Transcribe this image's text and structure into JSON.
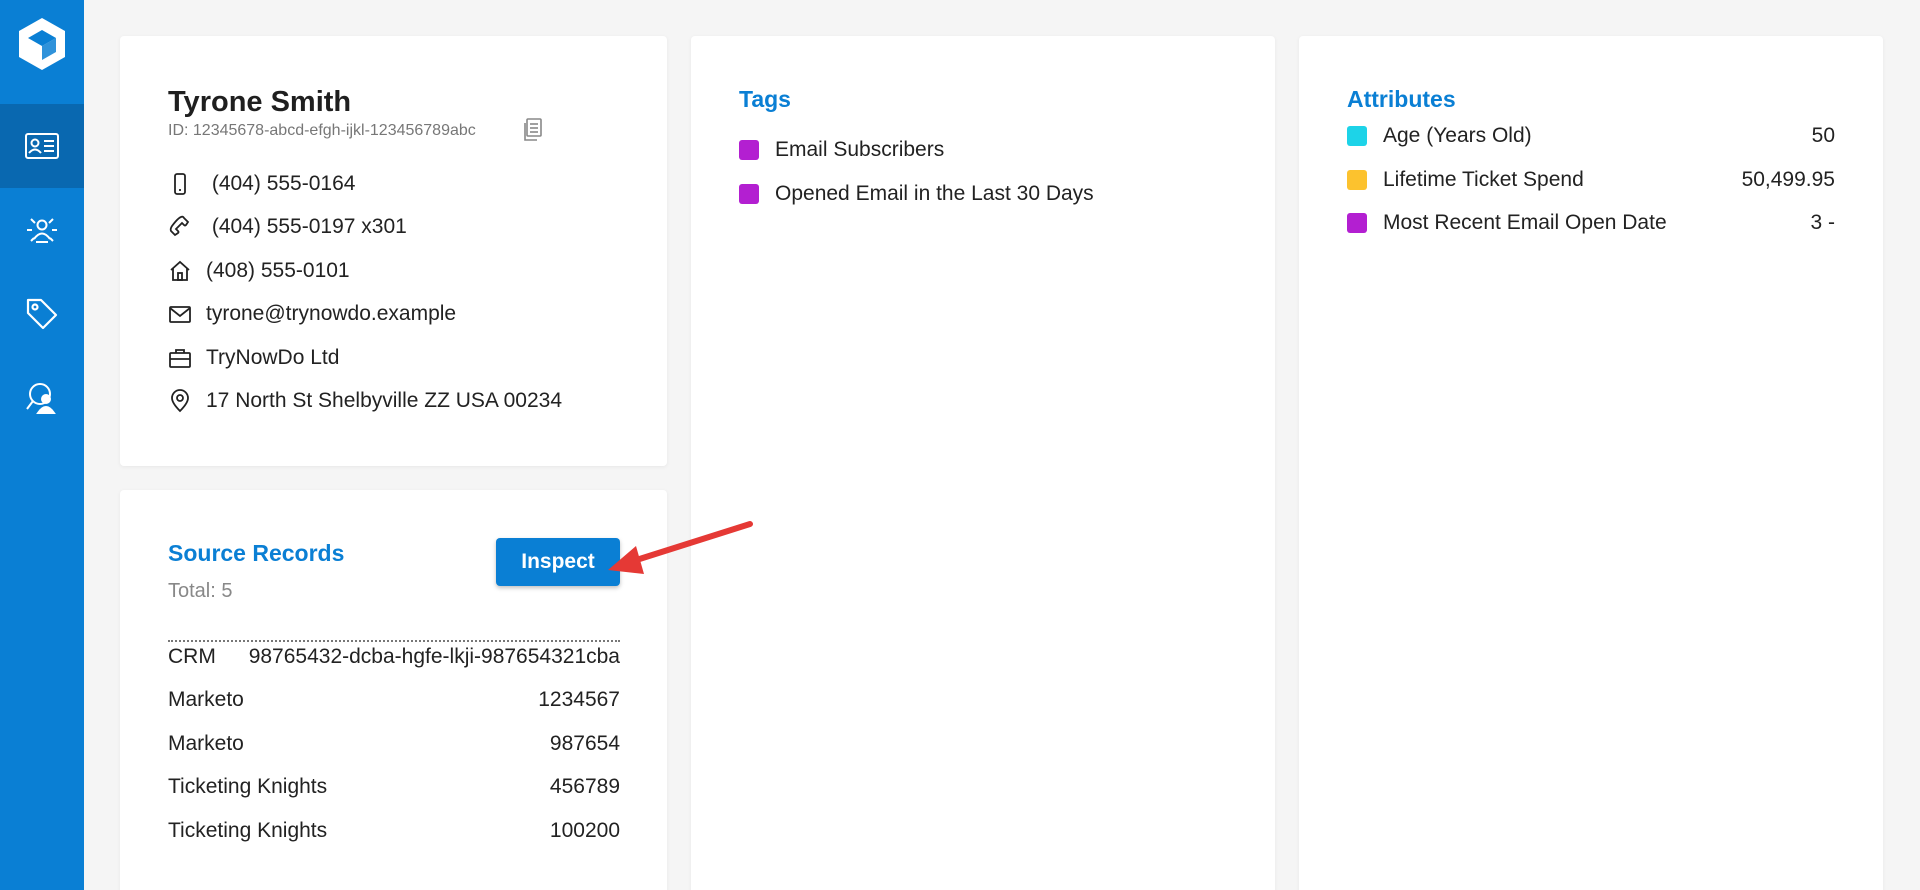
{
  "sidebar": {
    "items": [
      {
        "icon": "contact-card-icon",
        "active": true
      },
      {
        "icon": "people-network-icon",
        "active": false
      },
      {
        "icon": "tag-icon",
        "active": false
      },
      {
        "icon": "person-search-icon",
        "active": false
      }
    ]
  },
  "profile": {
    "name": "Tyrone Smith",
    "id": "ID: 12345678-abcd-efgh-ijkl-123456789abc",
    "contacts": [
      {
        "icon": "mobile-phone-icon",
        "value": " (404) 555-0164"
      },
      {
        "icon": "phone-icon",
        "value": " (404) 555-0197 x301"
      },
      {
        "icon": "home-icon",
        "value": "(408) 555-0101"
      },
      {
        "icon": "mail-icon",
        "value": "tyrone@trynowdo.example"
      },
      {
        "icon": "briefcase-icon",
        "value": "TryNowDo Ltd"
      },
      {
        "icon": "location-pin-icon",
        "value": "17 North St Shelbyville ZZ USA 00234"
      }
    ]
  },
  "source_records": {
    "title": "Source Records",
    "total": "Total: 5",
    "inspect_label": "Inspect",
    "records": [
      {
        "source": "CRM",
        "id": "98765432-dcba-hgfe-lkji-987654321cba"
      },
      {
        "source": "Marketo",
        "id": "1234567"
      },
      {
        "source": "Marketo",
        "id": "987654"
      },
      {
        "source": "Ticketing Knights",
        "id": "456789"
      },
      {
        "source": "Ticketing Knights",
        "id": "100200"
      }
    ]
  },
  "tags": {
    "title": "Tags",
    "items": [
      {
        "label": "Email Subscribers",
        "color": "#b31fd1"
      },
      {
        "label": "Opened Email in the Last 30 Days",
        "color": "#b31fd1"
      }
    ]
  },
  "attributes": {
    "title": "Attributes",
    "items": [
      {
        "label": "Age (Years Old)",
        "value": "50",
        "color": "#1dd3e8"
      },
      {
        "label": "Lifetime Ticket Spend",
        "value": "50,499.95",
        "color": "#fcc22e"
      },
      {
        "label": "Most Recent Email Open Date",
        "value": "3 -",
        "color": "#b31fd1"
      }
    ]
  },
  "colors": {
    "brand": "#0a7fd4",
    "annotation_arrow": "#e53935"
  }
}
